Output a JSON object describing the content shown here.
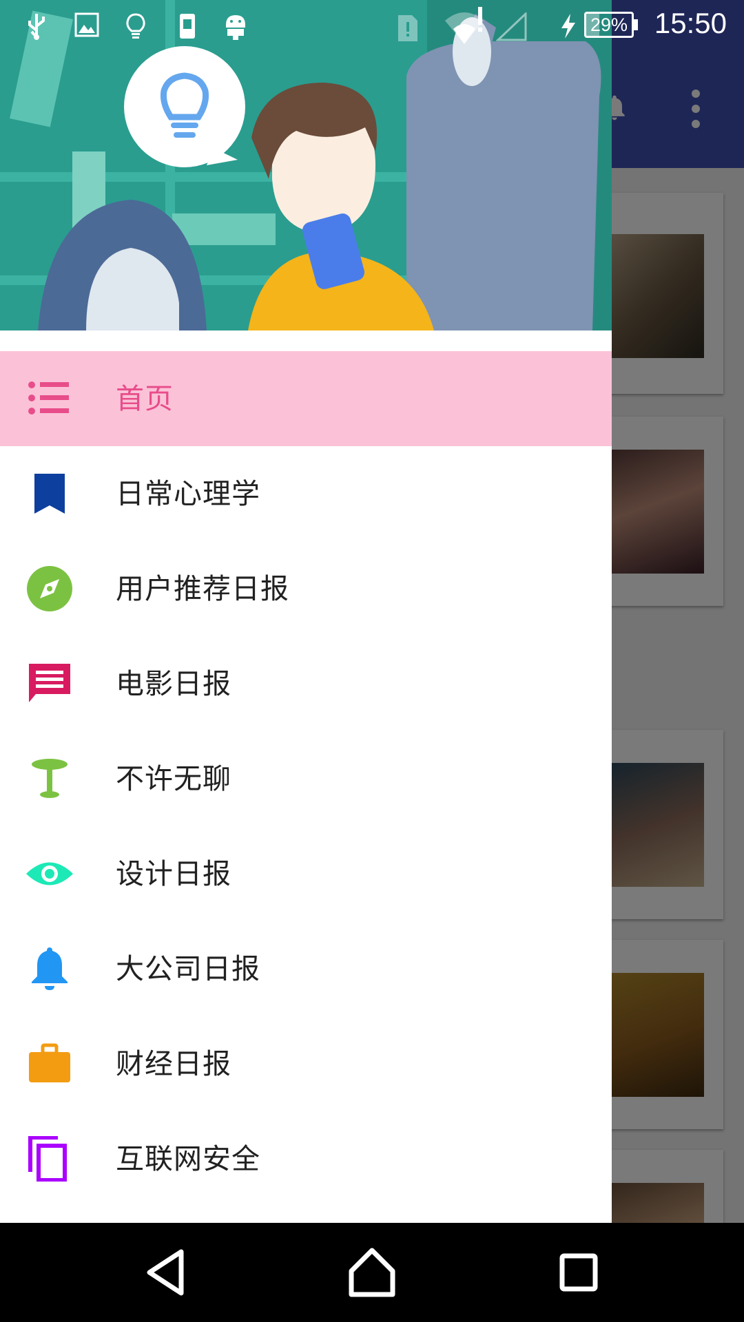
{
  "status_bar": {
    "time": "15:50",
    "battery": "29%",
    "battery_level": 0.29,
    "icons": [
      "usb-icon",
      "image-icon",
      "lightbulb-icon",
      "sim-icon",
      "android-icon",
      "sim-card-icon",
      "wifi-icon",
      "signal-icon",
      "charging-icon"
    ]
  },
  "drawer": {
    "header_illustration": "people-with-lightbulb-illustration",
    "selected_index": 0,
    "selected_bg": "#fbc2d7",
    "selected_text": "#e84d8a",
    "items": [
      {
        "label": "首页",
        "icon": "list-icon",
        "color": "#e84d8a"
      },
      {
        "label": "日常心理学",
        "icon": "bookmark-icon",
        "color": "#0d3f9e"
      },
      {
        "label": "用户推荐日报",
        "icon": "compass-icon",
        "color": "#7cc242"
      },
      {
        "label": "电影日报",
        "icon": "message-icon",
        "color": "#d81b60"
      },
      {
        "label": "不许无聊",
        "icon": "lamp-icon",
        "color": "#7cc242"
      },
      {
        "label": "设计日报",
        "icon": "eye-icon",
        "color": "#1de9b6"
      },
      {
        "label": "大公司日报",
        "icon": "bell-icon",
        "color": "#2196f3"
      },
      {
        "label": "财经日报",
        "icon": "briefcase-icon",
        "color": "#f39c12"
      },
      {
        "label": "互联网安全",
        "icon": "copy-icon",
        "color": "#aa00ff"
      }
    ]
  },
  "background_app": {
    "toolbar_color": "#3f51b5",
    "toolbar_icons": [
      "notifications-icon",
      "more-vert-icon"
    ]
  },
  "nav_bar": {
    "buttons": [
      "back-button",
      "home-button",
      "recents-button"
    ]
  }
}
